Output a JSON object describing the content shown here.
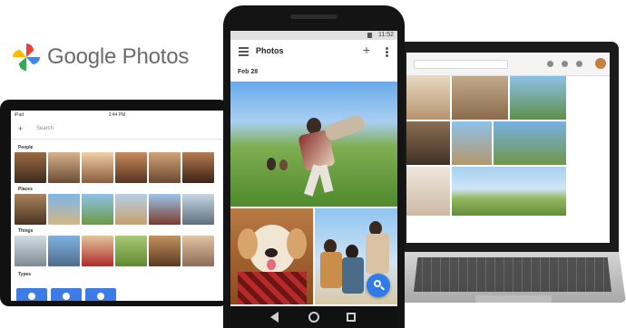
{
  "logo": {
    "wordmark": "Google Photos",
    "colors": [
      "#ea4335",
      "#fbbc05",
      "#34a853",
      "#4285f4"
    ]
  },
  "phone": {
    "status_time": "11:52",
    "app_title": "Photos",
    "date_header": "Feb 28",
    "icons": [
      "menu-icon",
      "add-icon",
      "more-vert-icon",
      "search-icon",
      "back-icon",
      "home-icon",
      "recents-icon"
    ],
    "fab_color": "#2f7be8"
  },
  "tablet": {
    "status_left": "iPad",
    "status_center": "2:44 PM",
    "search_placeholder": "Search",
    "sections": [
      "People",
      "Places",
      "Things",
      "Types"
    ]
  },
  "laptop": {
    "browser": "chrome",
    "grid_rows": 3
  }
}
